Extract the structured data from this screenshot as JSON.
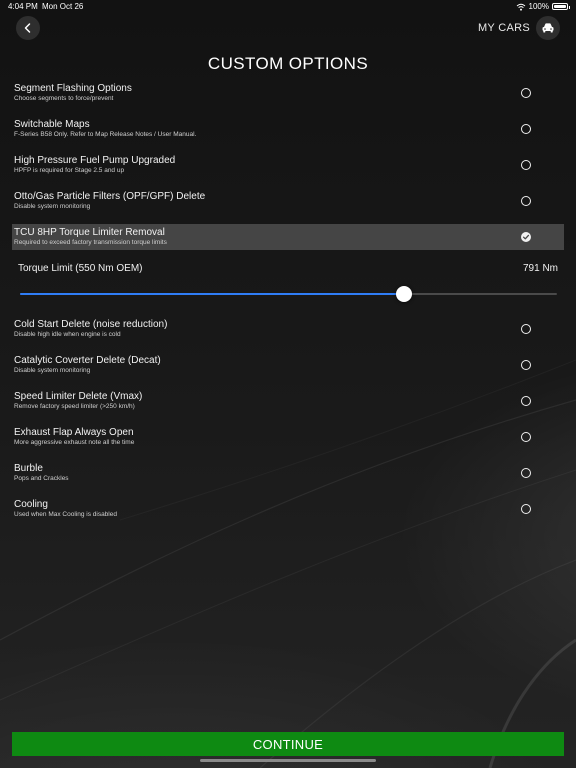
{
  "status_bar": {
    "time": "4:04 PM",
    "date": "Mon Oct 26",
    "battery": "100%",
    "icons": [
      "wifi-icon",
      "battery-icon"
    ]
  },
  "header": {
    "back_icon": "chevron-left-icon",
    "my_cars_label": "MY CARS",
    "car_icon": "car-icon",
    "title": "CUSTOM OPTIONS"
  },
  "options_top": [
    {
      "title": "Segment Flashing Options",
      "subtitle": "Choose segments to force/prevent",
      "selected": false
    },
    {
      "title": "Switchable Maps",
      "subtitle": "F-Series B58 Only. Refer to Map Release Notes / User Manual.",
      "selected": false
    },
    {
      "title": "High Pressure Fuel Pump Upgraded",
      "subtitle": "HPFP is required for Stage 2.5 and up",
      "selected": false
    },
    {
      "title": "Otto/Gas Particle Filters (OPF/GPF) Delete",
      "subtitle": "Disable system monitoring",
      "selected": false
    },
    {
      "title": "TCU 8HP Torque Limiter Removal",
      "subtitle": "Required to exceed factory transmission torque limits",
      "selected": true
    }
  ],
  "torque_slider": {
    "label": "Torque Limit (550 Nm OEM)",
    "value_text": "791 Nm",
    "fraction": 0.715
  },
  "options_bottom": [
    {
      "title": "Cold Start Delete (noise reduction)",
      "subtitle": "Disable high idle when engine is cold",
      "selected": false
    },
    {
      "title": "Catalytic Coverter Delete (Decat)",
      "subtitle": "Disable system monitoring",
      "selected": false
    },
    {
      "title": "Speed Limiter Delete (Vmax)",
      "subtitle": "Remove factory speed limiter (>250 km/h)",
      "selected": false
    },
    {
      "title": "Exhaust Flap Always Open",
      "subtitle": "More aggressive exhaust note all the time",
      "selected": false
    },
    {
      "title": "Burble",
      "subtitle": "Pops and Crackles",
      "selected": false
    },
    {
      "title": "Cooling",
      "subtitle": "Used when Max Cooling is disabled",
      "selected": false
    }
  ],
  "continue_label": "CONTINUE",
  "colors": {
    "accent_green": "#0e8a12",
    "slider_blue": "#2f7df6",
    "selected_row": "#454545"
  }
}
